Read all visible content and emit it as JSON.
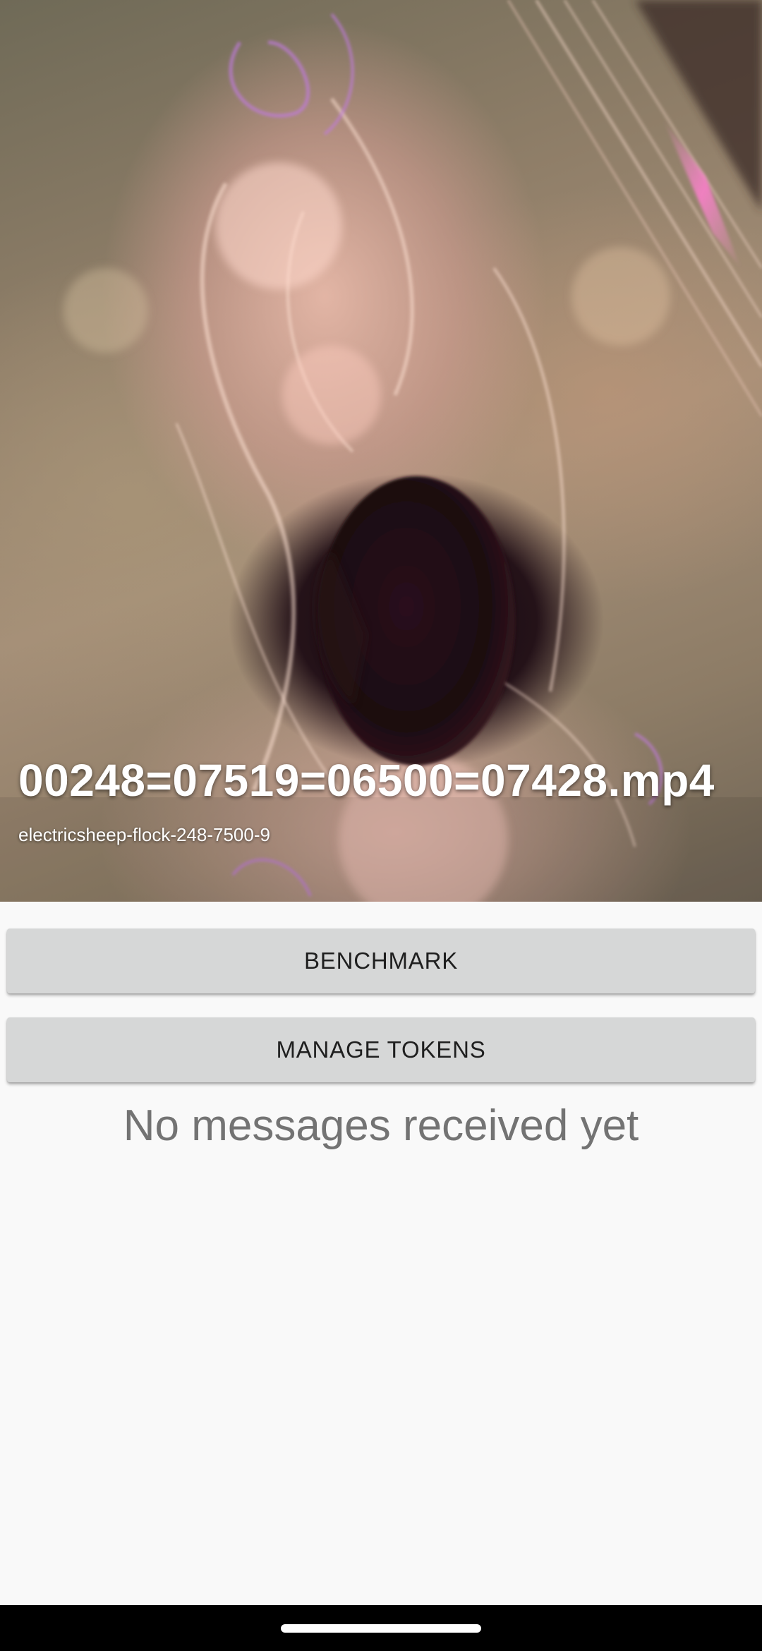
{
  "video": {
    "title": "00248=07519=06500=07428.mp4",
    "subtitle": "electricsheep-flock-248-7500-9"
  },
  "buttons": {
    "benchmark": "BENCHMARK",
    "manage_tokens": "MANAGE TOKENS"
  },
  "messages": {
    "empty_text": "No messages received yet"
  },
  "colors": {
    "background": "#f9f9f9",
    "button_bg": "#d6d7d7",
    "button_text": "#1f1f1f",
    "message_text": "#737373",
    "nav_bar": "#000000"
  }
}
